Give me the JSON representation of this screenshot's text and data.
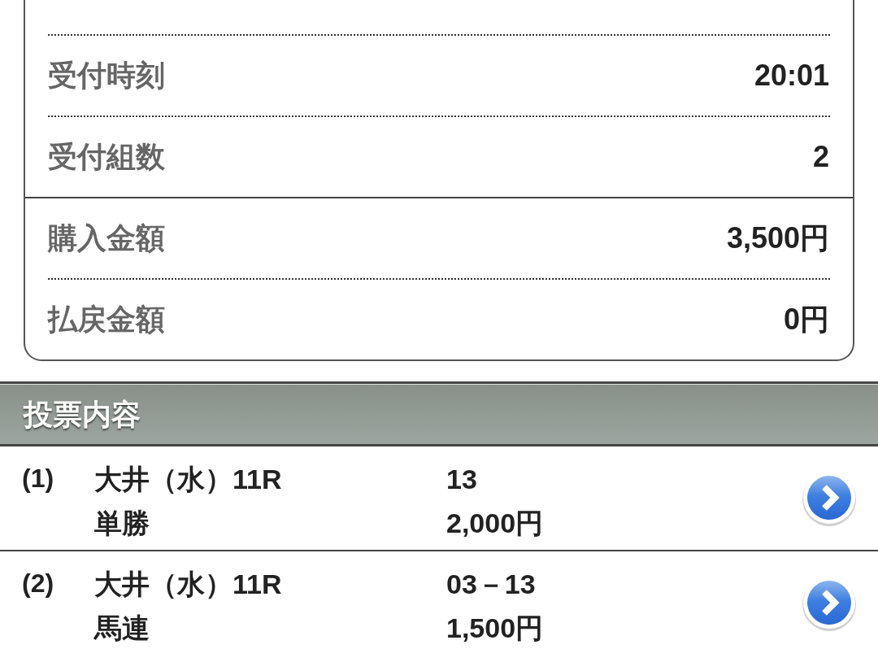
{
  "receipt_summary": {
    "reception": [
      {
        "label": "受付時刻",
        "value": "20:01"
      },
      {
        "label": "受付組数",
        "value": "2"
      }
    ],
    "amounts": [
      {
        "label": "購入金額",
        "value": "3,500円"
      },
      {
        "label": "払戻金額",
        "value": "0円"
      }
    ]
  },
  "section_header": {
    "title": "投票内容"
  },
  "bets": [
    {
      "number": "(1)",
      "race": "大井（水）11R",
      "bet_type": "単勝",
      "selection": "13",
      "amount": "2,000円"
    },
    {
      "number": "(2)",
      "race": "大井（水）11R",
      "bet_type": "馬連",
      "selection": "03－13",
      "amount": "1,500円"
    }
  ]
}
